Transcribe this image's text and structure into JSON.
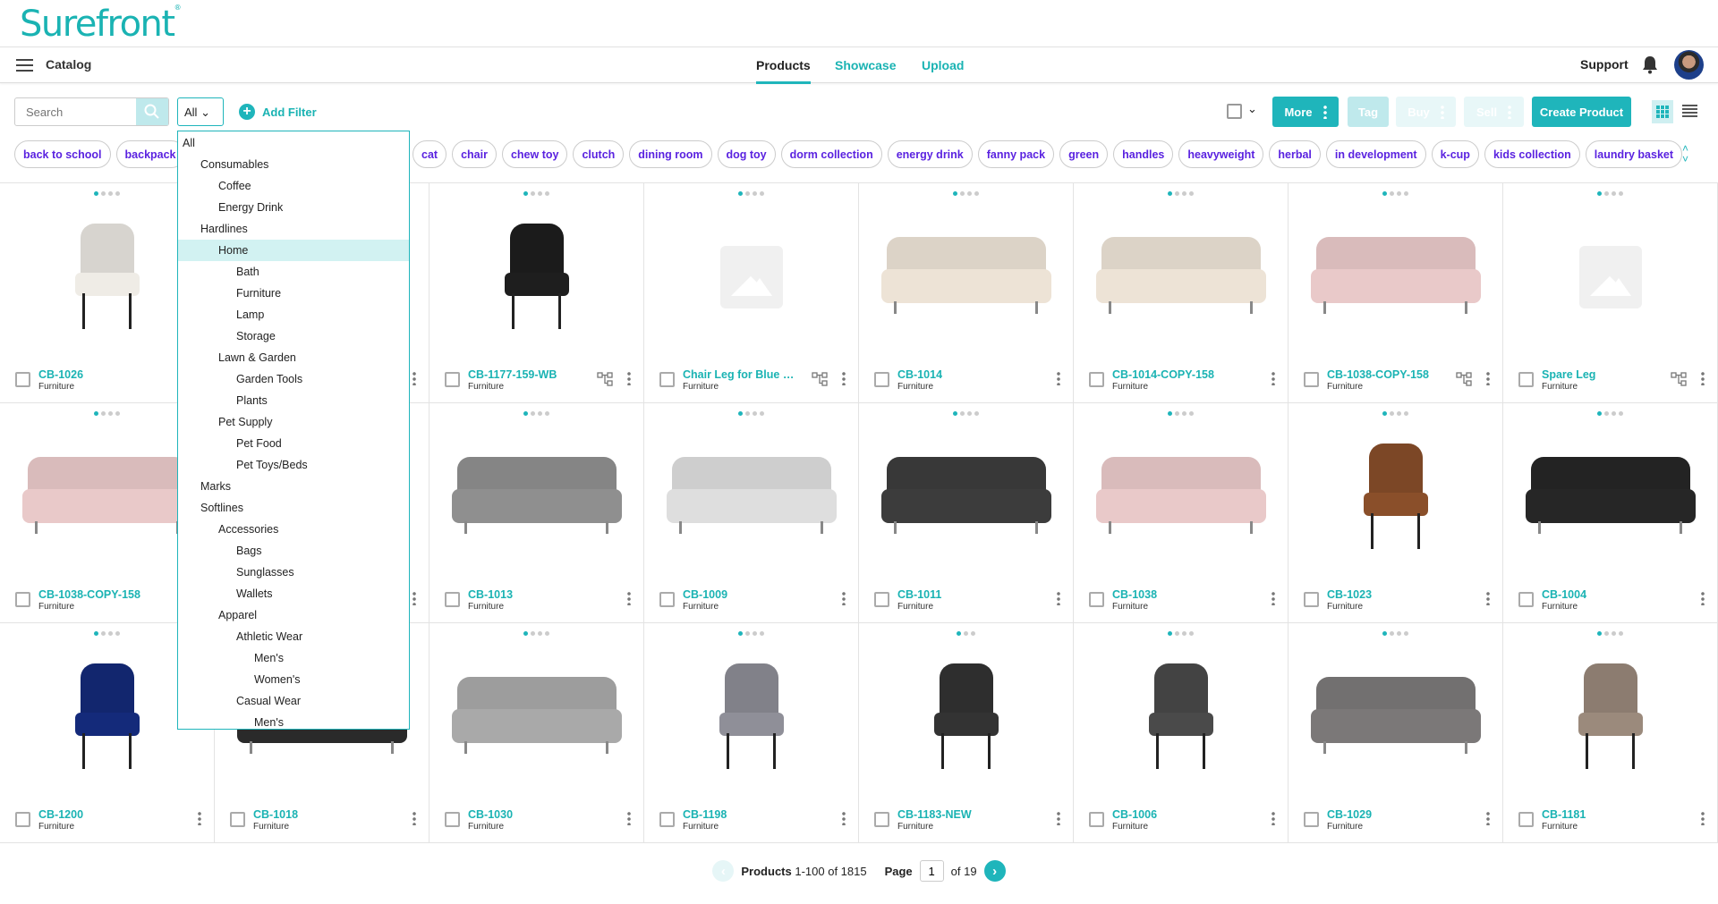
{
  "brand": {
    "logo": "Surefront",
    "accent": "#1fb5bb",
    "tag_color": "#5a22e0"
  },
  "nav": {
    "section": "Catalog",
    "tabs": [
      {
        "label": "Products",
        "active": true
      },
      {
        "label": "Showcase"
      },
      {
        "label": "Upload"
      }
    ],
    "support": "Support",
    "bell_icon": "bell-icon",
    "avatar": "user-avatar"
  },
  "toolbar": {
    "search_placeholder": "Search",
    "category_select": "All",
    "add_filter": "Add Filter",
    "more": "More",
    "tag": "Tag",
    "buy": "Buy",
    "sell": "Sell",
    "create_product": "Create Product",
    "view": "grid"
  },
  "tags_left": [
    "back to school",
    "backpack"
  ],
  "tags_right": [
    "cat",
    "chair",
    "chew toy",
    "clutch",
    "dining room",
    "dog toy",
    "dorm collection",
    "energy drink",
    "fanny pack",
    "green",
    "handles",
    "heavyweight",
    "herbal",
    "in development",
    "k-cup",
    "kids collection",
    "laundry basket"
  ],
  "category_dropdown": {
    "items": [
      {
        "label": "All",
        "level": 0
      },
      {
        "label": "Consumables",
        "level": 1
      },
      {
        "label": "Coffee",
        "level": 2
      },
      {
        "label": "Energy Drink",
        "level": 2
      },
      {
        "label": "Hardlines",
        "level": 1
      },
      {
        "label": "Home",
        "level": 2,
        "highlighted": true
      },
      {
        "label": "Bath",
        "level": 3
      },
      {
        "label": "Furniture",
        "level": 3
      },
      {
        "label": "Lamp",
        "level": 3
      },
      {
        "label": "Storage",
        "level": 3
      },
      {
        "label": "Lawn & Garden",
        "level": 2
      },
      {
        "label": "Garden Tools",
        "level": 3
      },
      {
        "label": "Plants",
        "level": 3
      },
      {
        "label": "Pet Supply",
        "level": 2
      },
      {
        "label": "Pet Food",
        "level": 3
      },
      {
        "label": "Pet Toys/Beds",
        "level": 3
      },
      {
        "label": "Marks",
        "level": 1
      },
      {
        "label": "Softlines",
        "level": 1
      },
      {
        "label": "Accessories",
        "level": 2
      },
      {
        "label": "Bags",
        "level": 3
      },
      {
        "label": "Sunglasses",
        "level": 3
      },
      {
        "label": "Wallets",
        "level": 3
      },
      {
        "label": "Apparel",
        "level": 2
      },
      {
        "label": "Athletic Wear",
        "level": 3
      },
      {
        "label": "Men's",
        "level": 4
      },
      {
        "label": "Women's",
        "level": 4
      },
      {
        "label": "Casual Wear",
        "level": 3
      },
      {
        "label": "Men's",
        "level": 4
      }
    ]
  },
  "products": [
    [
      {
        "name": "CB-1026",
        "category": "Furniture",
        "image": "chair",
        "color": "#efece6"
      },
      {
        "name": "",
        "category": "",
        "image": "sofa",
        "color": "#ddd"
      },
      {
        "name": "CB-1177-159-WB",
        "category": "Furniture",
        "image": "chair",
        "color": "#1e1e1e",
        "variants": true
      },
      {
        "name": "Chair Leg for Blue W...",
        "category": "Furniture",
        "image": "placeholder",
        "variants": true
      },
      {
        "name": "CB-1014",
        "category": "Furniture",
        "image": "sofa",
        "color": "#ede3d6"
      },
      {
        "name": "CB-1014-COPY-158",
        "category": "Furniture",
        "image": "sofa",
        "color": "#ede3d6"
      },
      {
        "name": "CB-1038-COPY-158",
        "category": "Furniture",
        "image": "sofa",
        "color": "#e9c9c9",
        "variants": true
      },
      {
        "name": "Spare Leg",
        "category": "Furniture",
        "image": "placeholder",
        "variants": true
      }
    ],
    [
      {
        "name": "CB-1038-COPY-158",
        "category": "Furniture",
        "image": "sofa",
        "color": "#e9c9c9"
      },
      {
        "name": "",
        "category": "",
        "image": "sofa",
        "color": "#ddd"
      },
      {
        "name": "CB-1013",
        "category": "Furniture",
        "image": "sofa",
        "color": "#8f8f8f"
      },
      {
        "name": "CB-1009",
        "category": "Furniture",
        "image": "sofa",
        "color": "#dedede"
      },
      {
        "name": "CB-1011",
        "category": "Furniture",
        "image": "sofa",
        "color": "#3c3c3c"
      },
      {
        "name": "CB-1038",
        "category": "Furniture",
        "image": "sofa",
        "color": "#e9c9c9"
      },
      {
        "name": "CB-1023",
        "category": "Furniture",
        "image": "chair",
        "color": "#8a4f2a"
      },
      {
        "name": "CB-1004",
        "category": "Furniture",
        "image": "sofa",
        "color": "#262626"
      }
    ],
    [
      {
        "name": "CB-1200",
        "category": "Furniture",
        "image": "chair",
        "color": "#142a7a"
      },
      {
        "name": "CB-1018",
        "category": "Furniture",
        "image": "sofa",
        "color": "#2a2a2a"
      },
      {
        "name": "CB-1030",
        "category": "Furniture",
        "image": "sofa",
        "color": "#a9a9a9"
      },
      {
        "name": "CB-1198",
        "category": "Furniture",
        "image": "chair",
        "color": "#8f8f98"
      },
      {
        "name": "CB-1183-NEW",
        "category": "Furniture",
        "image": "chair",
        "color": "#333"
      },
      {
        "name": "CB-1006",
        "category": "Furniture",
        "image": "chair",
        "color": "#4a4a4a"
      },
      {
        "name": "CB-1029",
        "category": "Furniture",
        "image": "sofa",
        "color": "#7b7878"
      },
      {
        "name": "CB-1181",
        "category": "Furniture",
        "image": "chair",
        "color": "#9b8a7c"
      }
    ]
  ],
  "pagination": {
    "label": "Products",
    "range": "1-100 of 1815",
    "page_label": "Page",
    "page": "1",
    "of_pages": "of 19"
  }
}
